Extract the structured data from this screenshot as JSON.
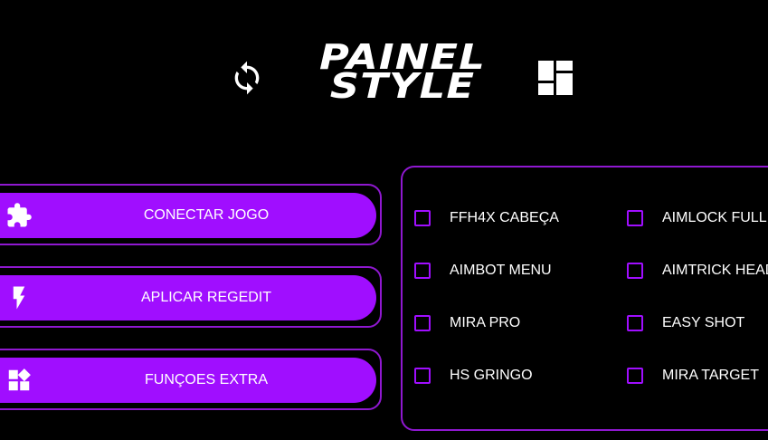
{
  "header": {
    "logo_line1": "PAINEL",
    "logo_line2": "STYLE",
    "refresh_icon": "refresh-icon",
    "grid_icon": "grid-icon"
  },
  "colors": {
    "background": "#000000",
    "accent": "#a00eff",
    "border": "#8f18d0",
    "text": "#ffffff"
  },
  "buttons": [
    {
      "label": "CONECTAR JOGO",
      "icon": "puzzle-icon"
    },
    {
      "label": "APLICAR REGEDIT",
      "icon": "lightning-icon"
    },
    {
      "label": "FUNÇOES EXTRA",
      "icon": "widgets-icon"
    }
  ],
  "options": [
    {
      "label": "FFH4X CABEÇA",
      "checked": false
    },
    {
      "label": "AIMLOCK FULL",
      "checked": false
    },
    {
      "label": "AIMBOT MENU",
      "checked": false
    },
    {
      "label": "AIMTRICK HEAD",
      "checked": false
    },
    {
      "label": "MIRA PRO",
      "checked": false
    },
    {
      "label": "EASY SHOT",
      "checked": false
    },
    {
      "label": "HS GRINGO",
      "checked": false
    },
    {
      "label": "MIRA TARGET",
      "checked": false
    }
  ]
}
